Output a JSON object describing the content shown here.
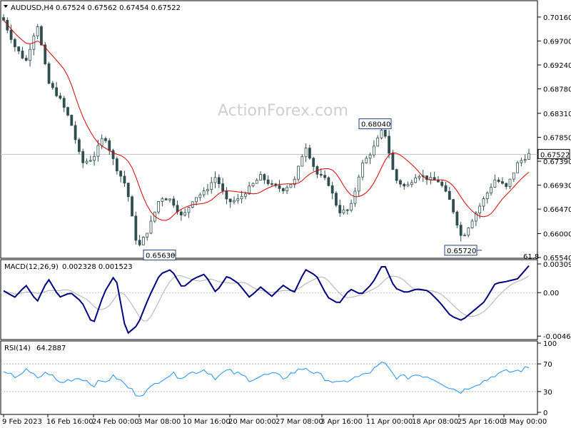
{
  "header": {
    "symbol": "AUDUSD,H4",
    "ohlc": "0.67524 0.67562 0.67454 0.67522"
  },
  "watermark": "ActionForex.com",
  "colors": {
    "candles": "#2f4f4f",
    "ma": "#d40000",
    "macd": "#000080",
    "signal": "#b0b0b0",
    "rsi": "#1e90ff",
    "price_line": "#c0c0c0"
  },
  "chart_data": [
    {
      "type": "candlestick",
      "title": "AUDUSD,H4",
      "yticks": [
        "0.70160",
        "0.69700",
        "0.69240",
        "0.68780",
        "0.68310",
        "0.67850",
        "0.67390",
        "0.66930",
        "0.66470",
        "0.66000",
        "0.65540"
      ],
      "ylim": [
        0.6554,
        0.7046
      ],
      "current_price": "0.67522",
      "annotations": [
        {
          "text": "0.65630",
          "value": 0.6563
        },
        {
          "text": "0.68040",
          "value": 0.6804
        },
        {
          "text": "0.65720",
          "value": 0.6572
        },
        {
          "text": "61.8",
          "value": 0.6554
        }
      ],
      "xticks": [
        "9 Feb 2023",
        "16 Feb 16:00",
        "24 Feb 00:00",
        "3 Mar 08:00",
        "10 Mar 16:00",
        "20 Mar 00:00",
        "27 Mar 08:00",
        "3 Apr 16:00",
        "11 Apr 00:00",
        "18 Apr 08:00",
        "25 Apr 16:00",
        "3 May 00:00"
      ],
      "close_anchors": [
        0.701,
        0.696,
        0.693,
        0.7005,
        0.689,
        0.686,
        0.6815,
        0.6735,
        0.6745,
        0.679,
        0.673,
        0.669,
        0.657,
        0.661,
        0.667,
        0.6665,
        0.663,
        0.6668,
        0.668,
        0.671,
        0.666,
        0.6665,
        0.6688,
        0.671,
        0.6692,
        0.6685,
        0.67,
        0.677,
        0.6715,
        0.67,
        0.6642,
        0.6645,
        0.673,
        0.676,
        0.6804,
        0.6705,
        0.6688,
        0.6715,
        0.6705,
        0.67,
        0.666,
        0.659,
        0.663,
        0.6668,
        0.6705,
        0.6688,
        0.6735,
        0.67522
      ]
    },
    {
      "type": "line",
      "title": "MACD(12,26,9)",
      "readout": "0.002328 0.001523",
      "yticks": [
        "0.003095",
        "0.00",
        "-0.004686"
      ],
      "ylim": [
        -0.0049,
        0.0034
      ],
      "macd_anchors": [
        0.0002,
        -0.0005,
        0.0008,
        -0.001,
        0.0015,
        -0.0005,
        0.0,
        -0.001,
        -0.0035,
        0.0,
        0.002,
        -0.0045,
        -0.0035,
        -0.0005,
        0.002,
        0.0025,
        0.0005,
        0.0015,
        0.002,
        0.0,
        0.0018,
        0.001,
        -0.0005,
        0.0006,
        -0.0004,
        0.0008,
        0.0,
        0.0025,
        0.0018,
        -0.0005,
        -0.0012,
        0.0004,
        -0.0002,
        0.001,
        0.0032,
        0.0005,
        0.0,
        0.0004,
        0.0002,
        -0.001,
        -0.0025,
        -0.003,
        -0.002,
        -0.001,
        0.001,
        0.0012,
        0.0015,
        0.0029
      ]
    },
    {
      "type": "line",
      "title": "RSI(14)",
      "readout": "64.2887",
      "yticks": [
        "100",
        "70",
        "30",
        "0"
      ],
      "ylim": [
        0,
        100
      ],
      "rsi_anchors": [
        55,
        52,
        60,
        50,
        58,
        42,
        48,
        50,
        40,
        45,
        52,
        38,
        25,
        32,
        48,
        55,
        52,
        58,
        62,
        50,
        60,
        55,
        48,
        52,
        55,
        50,
        58,
        65,
        55,
        48,
        40,
        48,
        52,
        60,
        72,
        52,
        50,
        55,
        52,
        45,
        35,
        30,
        40,
        45,
        55,
        58,
        60,
        64.2887
      ]
    }
  ]
}
